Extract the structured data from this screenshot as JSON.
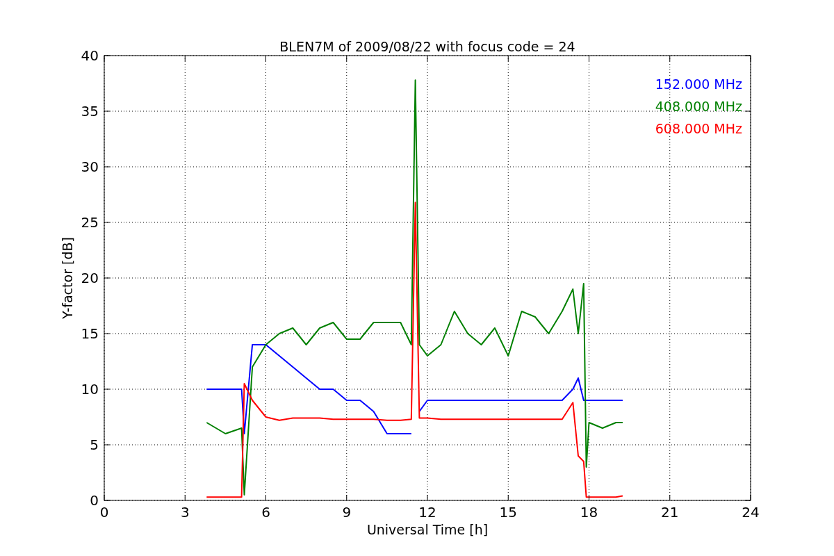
{
  "chart_data": {
    "type": "line",
    "title": "BLEN7M of 2009/08/22 with focus code = 24",
    "xlabel": "Universal Time [h]",
    "ylabel": "Y-factor [dB]",
    "grid": true,
    "xlim": [
      0,
      24
    ],
    "ylim": [
      0,
      40
    ],
    "xticks": [
      0,
      3,
      6,
      9,
      12,
      15,
      18,
      21,
      24
    ],
    "yticks": [
      0,
      5,
      10,
      15,
      20,
      25,
      30,
      35,
      40
    ],
    "x": [
      3.8,
      4.5,
      5.1,
      5.2,
      5.5,
      6,
      6.5,
      7,
      7.5,
      8,
      8.5,
      9,
      9.5,
      10,
      10.5,
      11,
      11.4,
      11.55,
      11.7,
      12,
      12.5,
      13,
      13.5,
      14,
      14.5,
      15,
      15.5,
      16,
      16.5,
      17,
      17.4,
      17.6,
      17.8,
      17.9,
      18,
      18.5,
      19,
      19.25
    ],
    "series": [
      {
        "name": "152.000 MHz",
        "color": "#0000ff",
        "values": [
          10,
          10,
          10,
          6,
          14,
          14,
          13,
          12,
          11,
          10,
          10,
          9,
          9,
          8,
          6,
          6,
          6,
          null,
          8,
          9,
          9,
          9,
          9,
          9,
          9,
          9,
          9,
          9,
          9,
          9,
          10,
          11,
          9,
          9,
          9,
          9,
          9,
          9
        ]
      },
      {
        "name": "408.000 MHz",
        "color": "#008000",
        "values": [
          7,
          6,
          6.5,
          0.5,
          12,
          14,
          15,
          15.5,
          14,
          15.5,
          16,
          14.5,
          14.5,
          16,
          16,
          16,
          14,
          37.8,
          14,
          13,
          14,
          17,
          15,
          14,
          15.5,
          13,
          17,
          16.5,
          15,
          17,
          19,
          15,
          19.5,
          3,
          7,
          6.5,
          7,
          7
        ]
      },
      {
        "name": "608.000 MHz",
        "color": "#ff0000",
        "values": [
          0.3,
          0.3,
          0.3,
          10.5,
          9,
          7.5,
          7.2,
          7.4,
          7.4,
          7.4,
          7.3,
          7.3,
          7.3,
          7.3,
          7.2,
          7.2,
          7.3,
          26.8,
          7.4,
          7.4,
          7.3,
          7.3,
          7.3,
          7.3,
          7.3,
          7.3,
          7.3,
          7.3,
          7.3,
          7.3,
          8.8,
          4,
          3.5,
          0.3,
          0.3,
          0.3,
          0.3,
          0.4
        ]
      }
    ]
  }
}
